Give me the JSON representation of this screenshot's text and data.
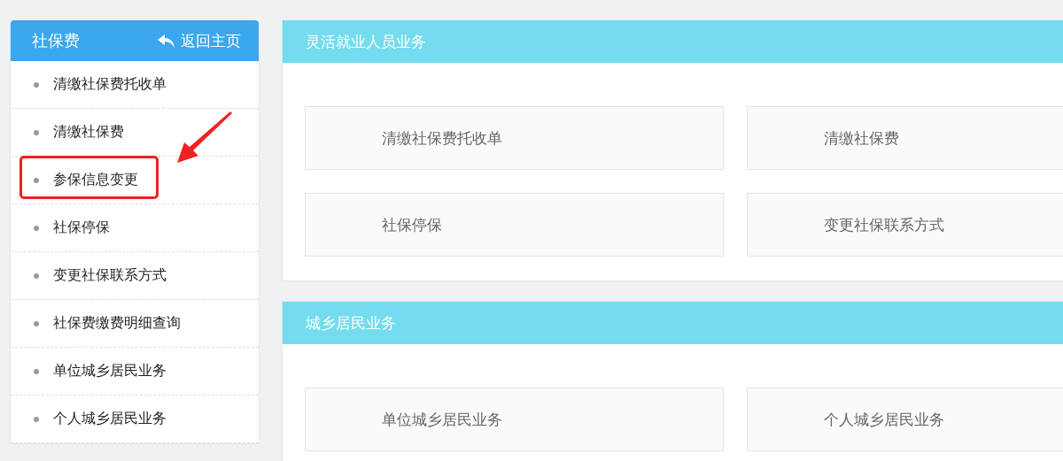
{
  "sidebar": {
    "title": "社保费",
    "back_link": "返回主页",
    "items": [
      {
        "label": "清缴社保费托收单",
        "highlighted": false
      },
      {
        "label": "清缴社保费",
        "highlighted": false
      },
      {
        "label": "参保信息变更",
        "highlighted": true
      },
      {
        "label": "社保停保",
        "highlighted": false
      },
      {
        "label": "变更社保联系方式",
        "highlighted": false
      },
      {
        "label": "社保费缴费明细查询",
        "highlighted": false
      },
      {
        "label": "单位城乡居民业务",
        "highlighted": false
      },
      {
        "label": "个人城乡居民业务",
        "highlighted": false
      }
    ]
  },
  "sections": [
    {
      "title": "灵活就业人员业务",
      "cards": [
        "清缴社保费托收单",
        "清缴社保费",
        "社保停保",
        "变更社保联系方式"
      ]
    },
    {
      "title": "城乡居民业务",
      "cards": [
        "单位城乡居民业务",
        "个人城乡居民业务"
      ]
    }
  ]
}
